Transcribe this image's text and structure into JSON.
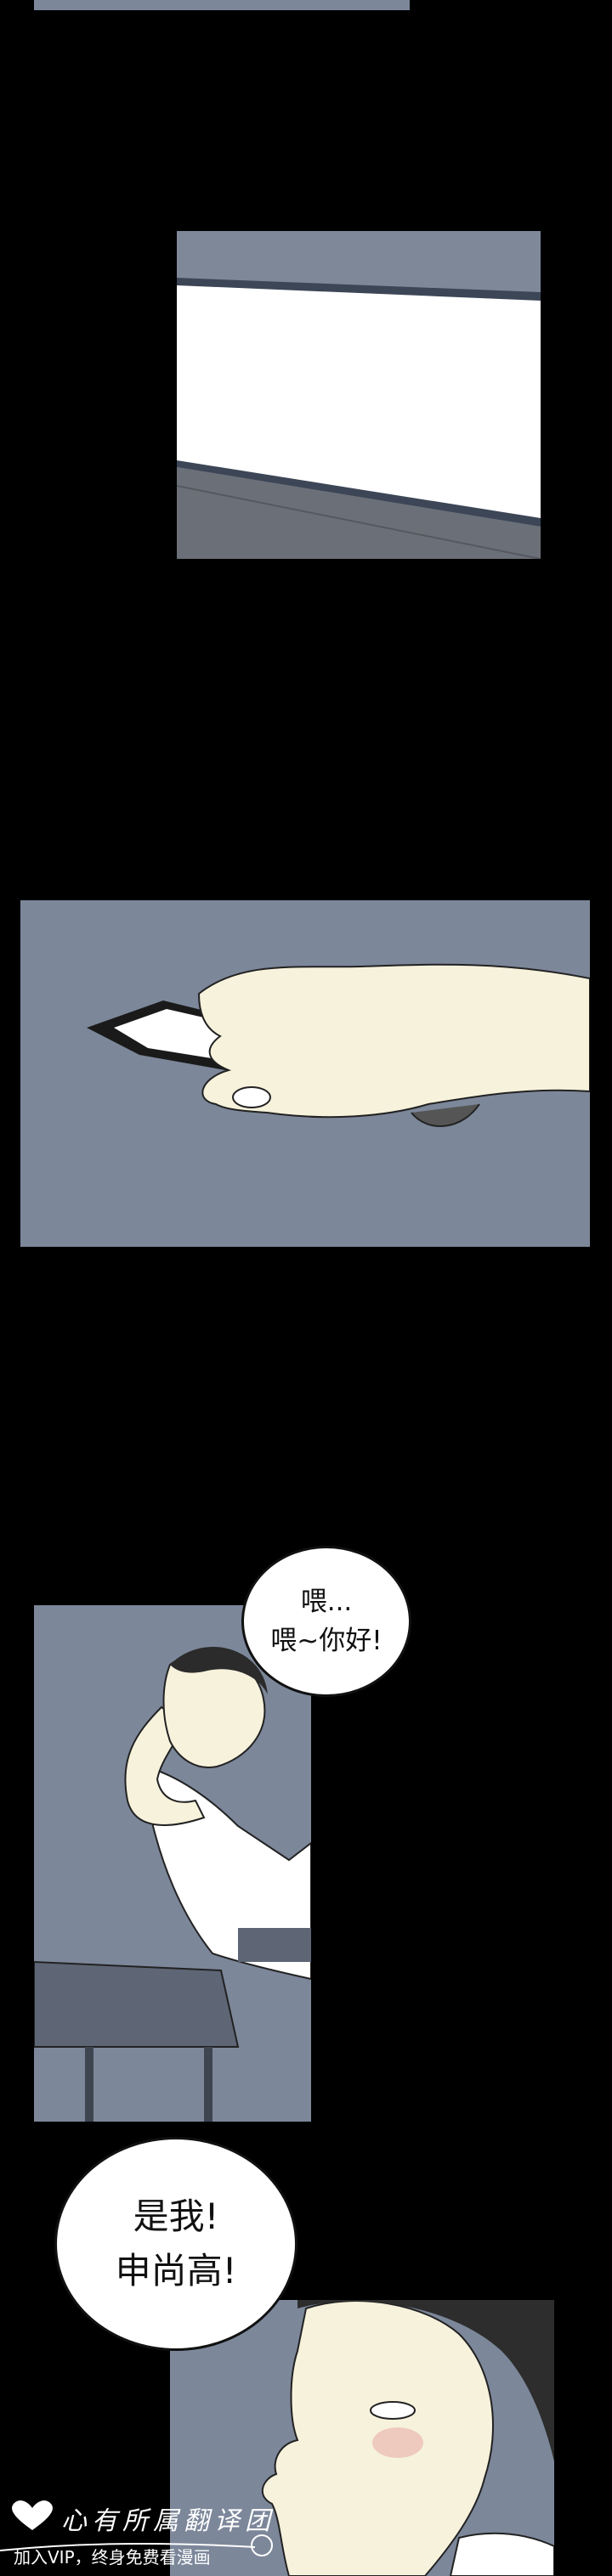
{
  "bubbles": {
    "hello": {
      "line1": "喂...",
      "line2": "喂~你好!"
    },
    "itsme": {
      "line1": "是我!",
      "line2": "申尚高!"
    }
  },
  "watermark": {
    "title": "心有所属翻译团",
    "subtitle": "加入VIP，终身免费看漫画"
  },
  "colors": {
    "background": "#000000",
    "panel_blue": "#7c879a",
    "phone_screen": "#ffffff",
    "skin": "#f7f2dc"
  }
}
